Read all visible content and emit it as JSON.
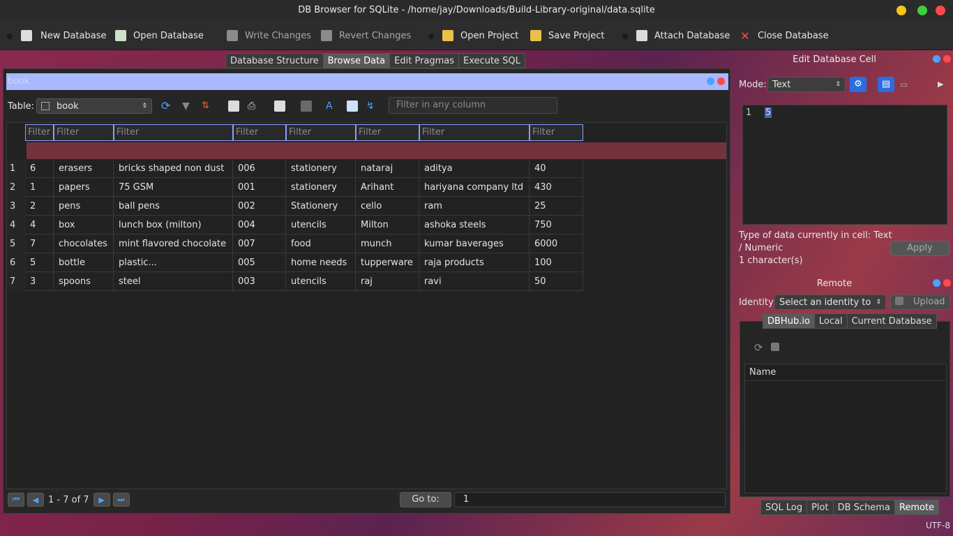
{
  "window": {
    "title": "DB Browser for SQLite - /home/jay/Downloads/Build-Library-original/data.sqlite"
  },
  "toolbar": {
    "new_database": "New Database",
    "open_database": "Open Database",
    "write_changes": "Write Changes",
    "revert_changes": "Revert Changes",
    "open_project": "Open Project",
    "save_project": "Save Project",
    "attach_database": "Attach Database",
    "close_database": "Close Database"
  },
  "main_tabs": [
    "Database Structure",
    "Browse Data",
    "Edit Pragmas",
    "Execute SQL"
  ],
  "browse": {
    "dock_title": "book",
    "table_label": "Table:",
    "table_value": "book",
    "filter_placeholder": "Filter in any column",
    "column_filter_placeholder": "Filter",
    "rows": [
      [
        "6",
        "erasers",
        " bricks shaped non dust",
        "006",
        "stationery",
        "nataraj",
        "aditya",
        "40"
      ],
      [
        "1",
        "papers",
        "75 GSM",
        "001",
        "stationery",
        "Arihant",
        "hariyana company ltd",
        "430"
      ],
      [
        "2",
        "pens",
        "ball pens",
        "002",
        "Stationery",
        "cello",
        "ram",
        "25"
      ],
      [
        "4",
        "box",
        "lunch box (milton)",
        "004",
        "utencils",
        "Milton",
        "ashoka steels",
        "750"
      ],
      [
        "7",
        "chocolates",
        "mint flavored chocolate",
        "007",
        "food",
        "munch",
        "kumar baverages",
        "6000"
      ],
      [
        "5",
        "bottle",
        "plastic...",
        "005",
        "home needs",
        "tupperware",
        "raja products",
        "100"
      ],
      [
        "3",
        "spoons",
        "steel",
        "003",
        "utencils",
        "raj",
        "ravi",
        "50"
      ]
    ],
    "row_numbers": [
      "1",
      "2",
      "3",
      "4",
      "5",
      "6",
      "7"
    ],
    "pager_text": "1 - 7 of 7",
    "goto_label": "Go to:",
    "goto_value": "1"
  },
  "edit_cell": {
    "title": "Edit Database Cell",
    "mode_label": "Mode:",
    "mode_value": "Text",
    "line_number": "1",
    "cell_value": "5",
    "type_info": "Type of data currently in cell: Text / Numeric",
    "char_count": "1 character(s)",
    "apply": "Apply"
  },
  "remote": {
    "title": "Remote",
    "identity_label": "Identity",
    "identity_placeholder": "Select an identity to c",
    "upload": "Upload",
    "tabs": [
      "DBHub.io",
      "Local",
      "Current Database"
    ],
    "name_header": "Name"
  },
  "bottom_tabs": [
    "SQL Log",
    "Plot",
    "DB Schema",
    "Remote"
  ],
  "status": {
    "encoding": "UTF-8"
  },
  "colors": {
    "accent_blue": "#4aa3ff",
    "selection_bar": "#a9b8ff",
    "close_red": "#ff4a4a",
    "min_yellow": "#f5c518",
    "max_green": "#3ecf3e"
  }
}
